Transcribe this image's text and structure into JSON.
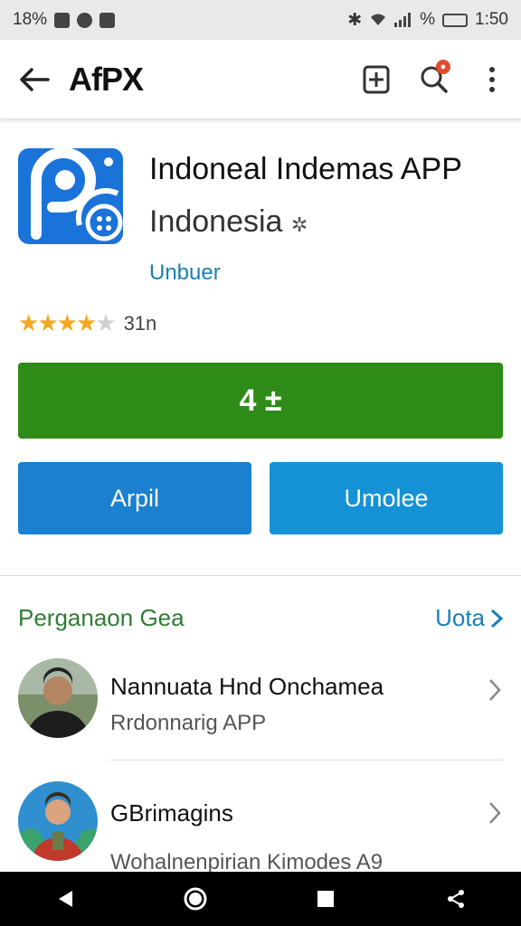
{
  "status_bar": {
    "left_text": "18%",
    "time": "1:50",
    "percent": "%"
  },
  "app_bar": {
    "title": "AfPX"
  },
  "app": {
    "name": "Indoneal Indemas APP",
    "subtitle": "Indonesia",
    "developer": "Unbuer",
    "rating": 3.5,
    "rating_max": 5,
    "rating_count": "31n"
  },
  "buttons": {
    "install_label": "4 ±",
    "left_label": "Arpil",
    "right_label": "Umolee"
  },
  "section": {
    "title": "Perganaon Gea",
    "more_label": "Uota"
  },
  "list": [
    {
      "title": "Nannuata Hnd Onchamea",
      "subtitle": "Rrdonnarig APP"
    },
    {
      "title": "GBrimagins",
      "subtitle": "Wohalnenpirian Kimodes A9"
    }
  ],
  "colors": {
    "install": "#2e8b17",
    "primary": "#1a80cf",
    "section_title": "#2e7d32",
    "link": "#1a7fb5",
    "star": "#f4a821"
  },
  "icons": [
    "arrow-left-icon",
    "add-box-icon",
    "search-icon",
    "more-vert-icon",
    "star-icon",
    "chevron-right-icon",
    "back-triangle-icon",
    "home-circle-icon",
    "recents-square-icon",
    "share-icon"
  ]
}
